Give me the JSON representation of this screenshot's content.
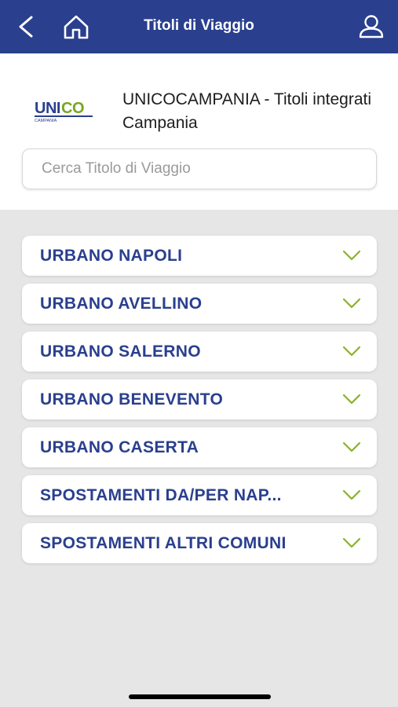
{
  "navbar": {
    "title": "Titoli di Viaggio",
    "back_icon": "chevron-left-icon",
    "home_icon": "home-icon",
    "user_icon": "user-icon",
    "background": "#2a3f8e"
  },
  "provider": {
    "logo_text": "UNICO",
    "logo_subtext": "CAMPANIA",
    "name": "UNICOCAMPANIA - Titoli integrati Campania"
  },
  "search": {
    "placeholder": "Cerca Titolo di Viaggio",
    "value": ""
  },
  "categories": [
    {
      "label": "URBANO NAPOLI"
    },
    {
      "label": "URBANO AVELLINO"
    },
    {
      "label": "URBANO SALERNO"
    },
    {
      "label": "URBANO BENEVENTO"
    },
    {
      "label": "URBANO CASERTA"
    },
    {
      "label": "SPOSTAMENTI DA/PER NAP..."
    },
    {
      "label": "SPOSTAMENTI ALTRI COMUNI"
    }
  ],
  "colors": {
    "accent": "#2a3f8e",
    "chevron": "#8ab227",
    "background": "#e6e6e6"
  }
}
